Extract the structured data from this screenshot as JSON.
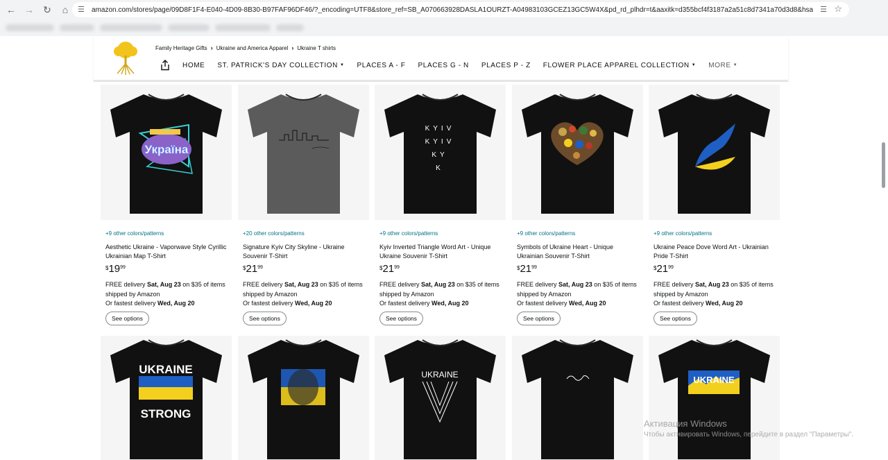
{
  "browser": {
    "url": "amazon.com/stores/page/09D8F1F4-E040-4D09-8B30-B97FAF96DF46/?_encoding=UTF8&store_ref=SB_A070663928DASLA1OURZT-A04983103GCEZ13GC5W4X&pd_rd_plhdr=t&aaxitk=d355bcf4f3187a2a51c8d7341a70d3d8&hsa_cr_id=0&lp_asins=B0..."
  },
  "store": {
    "breadcrumb": [
      "Family Heritage Gifts",
      "Ukraine and America Apparel",
      "Ukraine T shirts"
    ],
    "nav": [
      {
        "label": "HOME",
        "dropdown": false
      },
      {
        "label": "ST. PATRICK'S DAY COLLECTION",
        "dropdown": true
      },
      {
        "label": "PLACES A - F",
        "dropdown": false
      },
      {
        "label": "PLACES G - N",
        "dropdown": false
      },
      {
        "label": "PLACES P - Z",
        "dropdown": false
      },
      {
        "label": "FLOWER PLACE APPAREL COLLECTION",
        "dropdown": true
      },
      {
        "label": "MORE",
        "dropdown": true
      }
    ]
  },
  "products": [
    {
      "colors": "+9 other colors/patterns",
      "title": "Aesthetic Ukraine - Vaporwave Style Cyrillic Ukrainian Map T-Shirt",
      "price_whole": "19",
      "price_frac": "99",
      "shirt": "black",
      "art": "vaporwave",
      "art_text": "Україна"
    },
    {
      "colors": "+20 other colors/patterns",
      "title": "Signature Kyiv City Skyline - Ukraine Souvenir T-Shirt",
      "price_whole": "21",
      "price_frac": "99",
      "shirt": "gray",
      "art": "skyline"
    },
    {
      "colors": "+9 other colors/patterns",
      "title": "Kyiv Inverted Triangle Word Art - Unique Ukraine Souvenir T-Shirt",
      "price_whole": "21",
      "price_frac": "99",
      "shirt": "black",
      "art": "kyiv",
      "art_lines": [
        "KYIV",
        "KYIV",
        "KY",
        "K"
      ]
    },
    {
      "colors": "+9 other colors/patterns",
      "title": "Symbols of Ukraine Heart - Unique Ukrainian Souvenir T-Shirt",
      "price_whole": "21",
      "price_frac": "99",
      "shirt": "black",
      "art": "heart"
    },
    {
      "colors": "+9 other colors/patterns",
      "title": "Ukraine Peace Dove Word Art - Ukrainian Pride T-Shirt",
      "price_whole": "21",
      "price_frac": "99",
      "shirt": "black",
      "art": "dove"
    }
  ],
  "products_row2": [
    {
      "shirt": "black",
      "art": "strong",
      "art_top": "UKRAINE",
      "art_bottom": "STRONG"
    },
    {
      "shirt": "black",
      "art": "lion"
    },
    {
      "shirt": "black",
      "art": "vtext",
      "art_text": "UKRAINE"
    },
    {
      "shirt": "black",
      "art": "signature"
    },
    {
      "shirt": "black",
      "art": "mountain",
      "art_text": "UKRAINE"
    }
  ],
  "delivery": {
    "line1_prefix": "FREE delivery ",
    "line1_date": "Sat, Aug 23",
    "line1_suffix": " on $35 of items shipped by Amazon",
    "line2_prefix": "Or fastest delivery ",
    "line2_date": "Wed, Aug 20"
  },
  "button_label": "See options",
  "currency": "$",
  "colors": {
    "accent_link": "#007185",
    "shirt_black": "#111111",
    "shirt_gray": "#5b5b5b",
    "ukraine_blue": "#1f5fc4",
    "ukraine_yellow": "#f3d01e"
  },
  "watermark": {
    "line1": "Активация Windows",
    "line2": "Чтобы активировать Windows, перейдите в раздел \"Параметры\"."
  }
}
